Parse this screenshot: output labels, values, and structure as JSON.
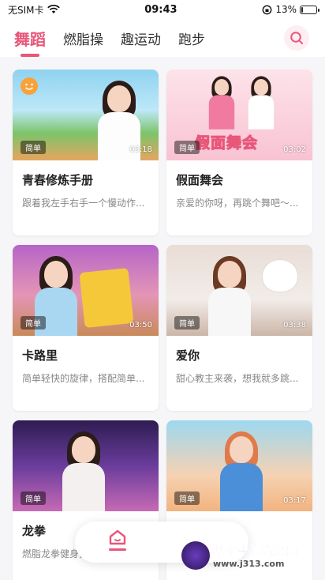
{
  "status": {
    "carrier": "无SIM卡",
    "time": "09:43",
    "battery": "13%",
    "battery_level": 0.13
  },
  "tabs": [
    {
      "label": "舞蹈",
      "active": true
    },
    {
      "label": "燃脂操",
      "active": false
    },
    {
      "label": "趣运动",
      "active": false
    },
    {
      "label": "跑步",
      "active": false
    }
  ],
  "accent_color": "#e8567a",
  "cards": [
    {
      "badge": "简单",
      "duration": "03:18",
      "title": "青春修炼手册",
      "desc": "跟着我左手右手一个慢动作..."
    },
    {
      "badge": "简单",
      "duration": "03:02",
      "title": "假面舞会",
      "desc": "亲爱的你呀，再跳个舞吧～...",
      "poster_text": "假面舞会"
    },
    {
      "badge": "简单",
      "duration": "03:50",
      "title": "卡路里",
      "desc": "简单轻快的旋律，搭配简单..."
    },
    {
      "badge": "简单",
      "duration": "03:38",
      "title": "爱你",
      "desc": "甜心教主来袭，想我就多跳..."
    },
    {
      "badge": "简单",
      "duration": "",
      "title": "龙拳",
      "desc": "燃脂龙拳健身操来了～"
    },
    {
      "badge": "简单",
      "duration": "03:17",
      "title": "",
      "desc": ""
    }
  ],
  "watermark": {
    "main": "基伞手游资源网",
    "url": "www.j313.com"
  }
}
